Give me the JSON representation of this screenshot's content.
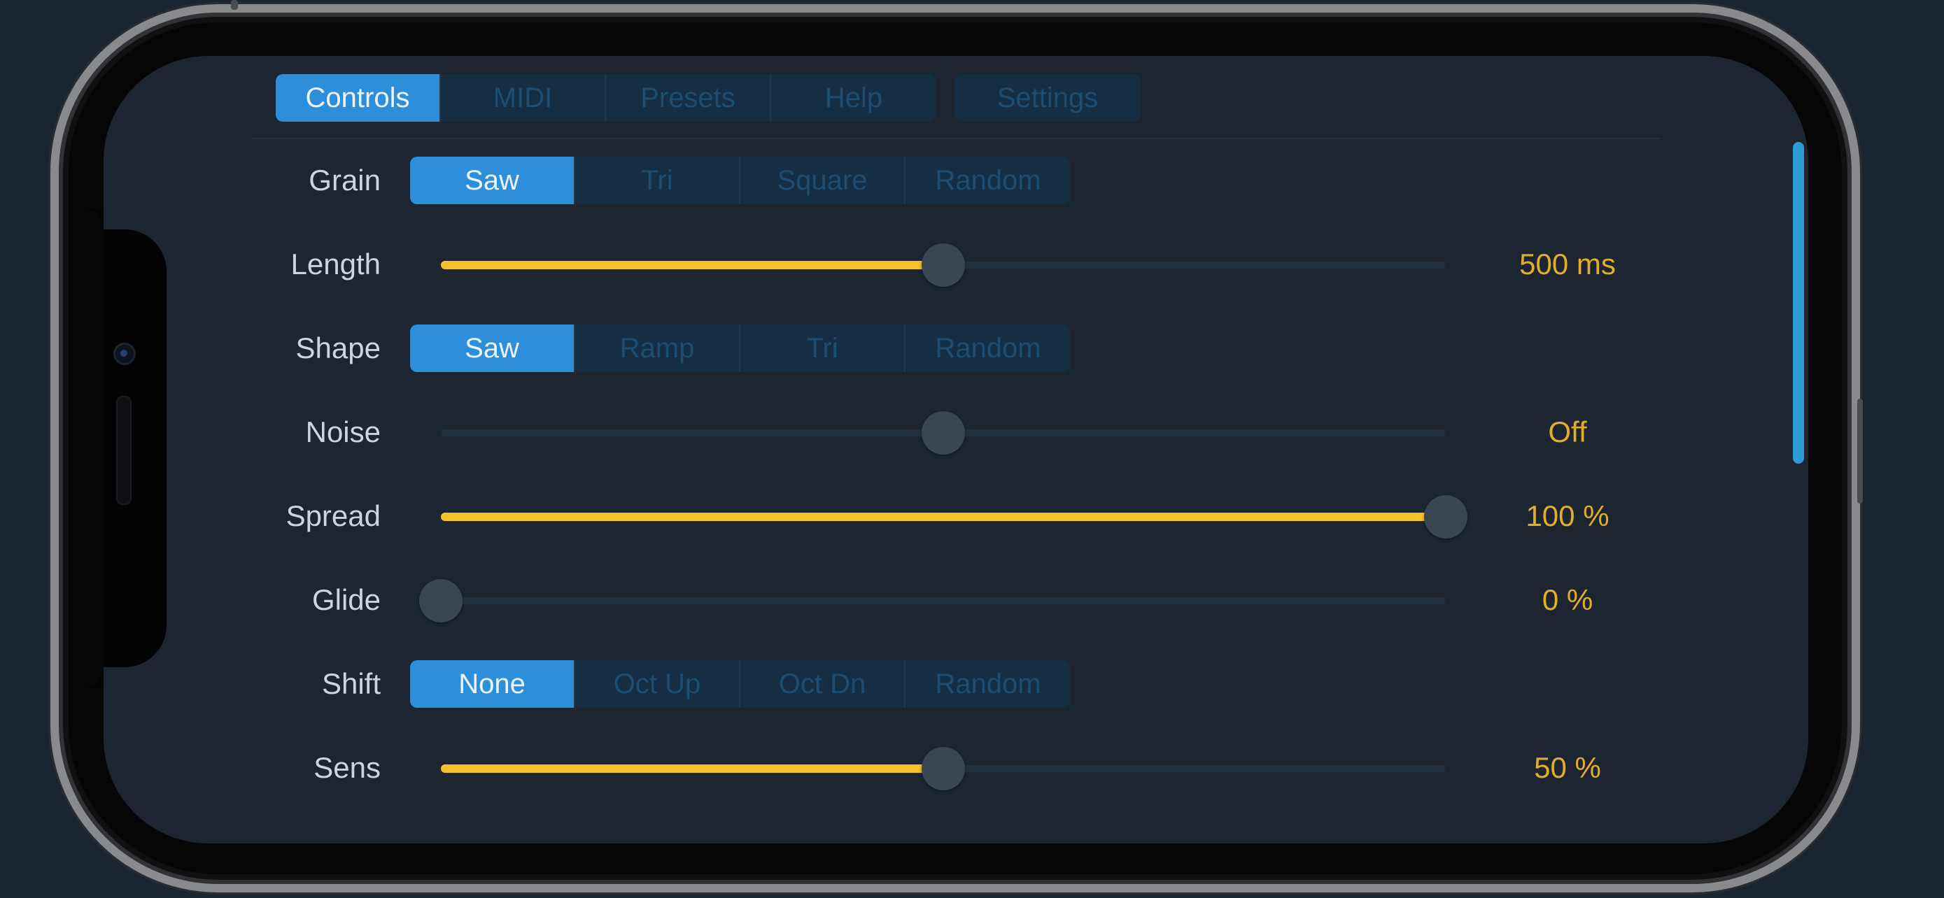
{
  "tabs": {
    "items": [
      {
        "label": "Controls",
        "active": true
      },
      {
        "label": "MIDI",
        "active": false
      },
      {
        "label": "Presets",
        "active": false
      },
      {
        "label": "Help",
        "active": false
      }
    ],
    "settings_label": "Settings"
  },
  "controls": {
    "grain": {
      "label": "Grain",
      "options": [
        "Saw",
        "Tri",
        "Square",
        "Random"
      ],
      "selected": "Saw"
    },
    "length": {
      "label": "Length",
      "value_text": "500 ms",
      "fraction": 0.5
    },
    "shape": {
      "label": "Shape",
      "options": [
        "Saw",
        "Ramp",
        "Tri",
        "Random"
      ],
      "selected": "Saw"
    },
    "noise": {
      "label": "Noise",
      "value_text": "Off",
      "fraction": 0.5,
      "filled": false
    },
    "spread": {
      "label": "Spread",
      "value_text": "100 %",
      "fraction": 1.0
    },
    "glide": {
      "label": "Glide",
      "value_text": "0 %",
      "fraction": 0.0
    },
    "shift": {
      "label": "Shift",
      "options": [
        "None",
        "Oct Up",
        "Oct Dn",
        "Random"
      ],
      "selected": "None"
    },
    "sens": {
      "label": "Sens",
      "value_text": "50 %",
      "fraction": 0.5
    }
  },
  "colors": {
    "accent_blue": "#2e8fd8",
    "slider_fill": "#f5c22b",
    "value_text": "#e1ad2c",
    "background": "#1c2530"
  }
}
